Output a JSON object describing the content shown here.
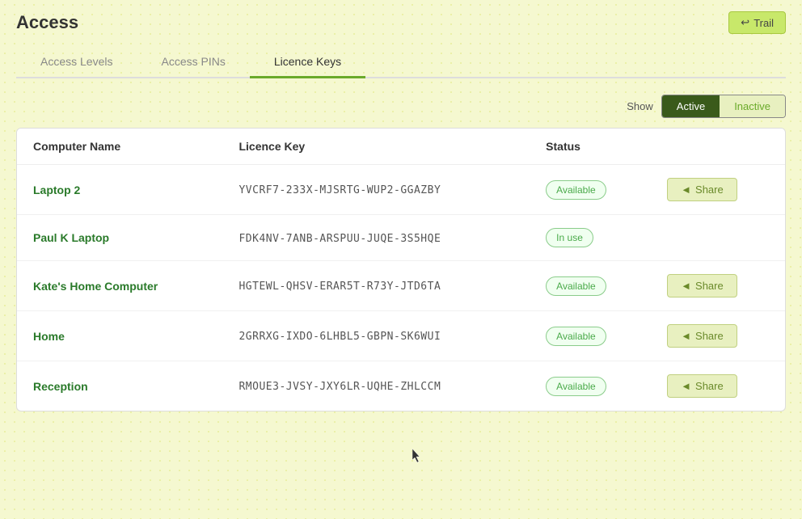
{
  "header": {
    "title": "Access",
    "trail_button": "Trail",
    "trail_icon": "↩"
  },
  "tabs": [
    {
      "id": "access-levels",
      "label": "Access Levels",
      "active": false
    },
    {
      "id": "access-pins",
      "label": "Access PINs",
      "active": false
    },
    {
      "id": "licence-keys",
      "label": "Licence Keys",
      "active": true
    }
  ],
  "show_controls": {
    "label": "Show",
    "options": [
      {
        "id": "active",
        "label": "Active",
        "selected": true
      },
      {
        "id": "inactive",
        "label": "Inactive",
        "selected": false
      }
    ]
  },
  "table": {
    "columns": [
      {
        "id": "computer-name",
        "label": "Computer Name"
      },
      {
        "id": "licence-key",
        "label": "Licence Key"
      },
      {
        "id": "status",
        "label": "Status"
      },
      {
        "id": "action",
        "label": ""
      }
    ],
    "rows": [
      {
        "id": "row-1",
        "computer_name": "Laptop 2",
        "licence_key": "YVCRF7-233X-MJSRTG-WUP2-GGAZBY",
        "status": "Available",
        "status_type": "available",
        "has_share": true
      },
      {
        "id": "row-2",
        "computer_name": "Paul K Laptop",
        "licence_key": "FDK4NV-7ANB-ARSPUU-JUQE-3S5HQE",
        "status": "In use",
        "status_type": "inuse",
        "has_share": false
      },
      {
        "id": "row-3",
        "computer_name": "Kate's Home Computer",
        "licence_key": "HGTEWL-QHSV-ERAR5T-R73Y-JTD6TA",
        "status": "Available",
        "status_type": "available",
        "has_share": true
      },
      {
        "id": "row-4",
        "computer_name": "Home",
        "licence_key": "2GRRXG-IXDO-6LHBL5-GBPN-SK6WUI",
        "status": "Available",
        "status_type": "available",
        "has_share": true
      },
      {
        "id": "row-5",
        "computer_name": "Reception",
        "licence_key": "RMOUE3-JVSY-JXY6LR-UQHE-ZHLCCM",
        "status": "Available",
        "status_type": "available",
        "has_share": true
      }
    ]
  },
  "share_label": "Share",
  "share_icon": "◄"
}
